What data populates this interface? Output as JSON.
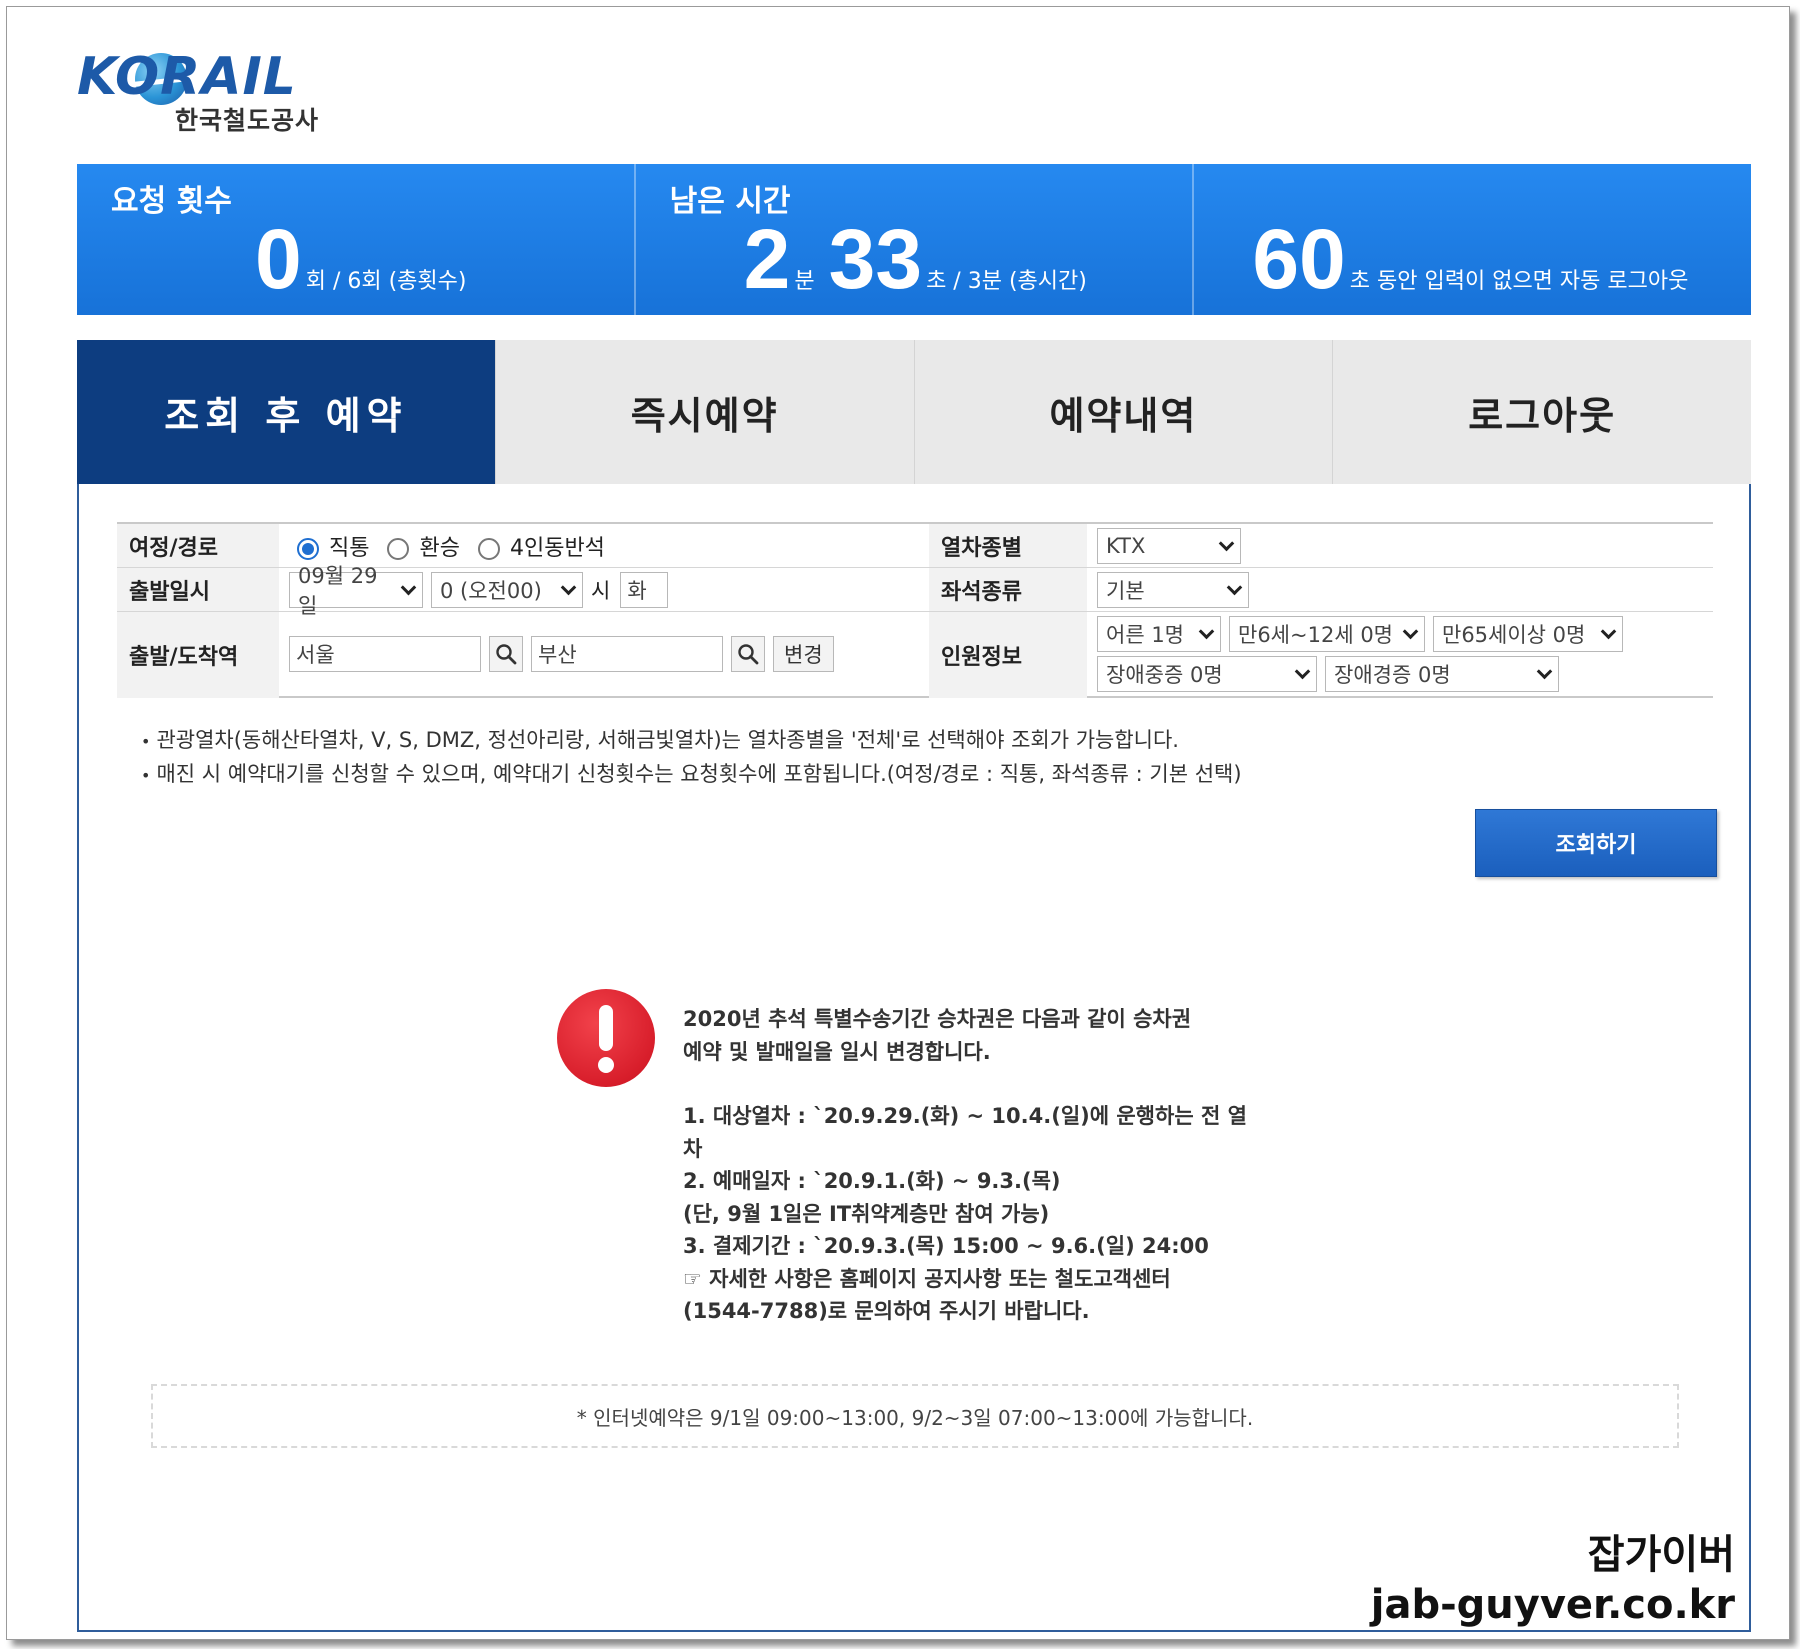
{
  "logo": {
    "wordmark": "KORAIL",
    "subtitle": "한국철도공사"
  },
  "stats": {
    "requests": {
      "title": "요청 횟수",
      "value": "0",
      "unit": "회 / 6회 (총횟수)"
    },
    "remaining": {
      "title": "남은 시간",
      "minutes": "2",
      "min_unit": "분",
      "seconds": "33",
      "sec_unit": "초 / 3분 (총시간)"
    },
    "idle": {
      "value": "60",
      "text": "초 동안 입력이 없으면 자동 로그아웃"
    }
  },
  "tabs": [
    {
      "label": "조회 후 예약"
    },
    {
      "label": "즉시예약"
    },
    {
      "label": "예약내역"
    },
    {
      "label": "로그아웃"
    }
  ],
  "form": {
    "route_label": "여정/경로",
    "route_options": [
      "직통",
      "환승",
      "4인동반석"
    ],
    "route_selected": "직통",
    "train_type_label": "열차종별",
    "train_type_value": "KTX",
    "date_label": "출발일시",
    "date_value": "09월 29일",
    "time_value": "0 (오전00)",
    "hour_suffix": "시",
    "weekday": "화",
    "seat_label": "좌석종류",
    "seat_value": "기본",
    "station_label": "출발/도착역",
    "from_station": "서울",
    "to_station": "부산",
    "change_button": "변경",
    "people_label": "인원정보",
    "adult": "어른 1명",
    "child": "만6세~12세 0명",
    "senior": "만65세이상 0명",
    "disabled_severe": "장애중증 0명",
    "disabled_mild": "장애경증 0명"
  },
  "notes": [
    "관광열차(동해산타열차, V, S, DMZ, 정선아리랑, 서해금빛열차)는 열차종별을 '전체'로 선택해야 조회가 가능합니다.",
    "매진 시 예약대기를 신청할 수 있으며, 예약대기 신청횟수는 요청횟수에 포함됩니다.(여정/경로 : 직통, 좌석종류 : 기본 선택)"
  ],
  "search_button": "조회하기",
  "notice": {
    "intro1": "2020년 추석 특별수송기간 승차권은 다음과 같이 승차권",
    "intro2": "예약 및 발매일을 일시 변경합니다.",
    "item1a": "1. 대상열차 : `20.9.29.(화) ~ 10.4.(일)에 운행하는 전 열",
    "item1b": "차",
    "item2a": "2. 예매일자 : `20.9.1.(화) ~ 9.3.(목)",
    "item2b": "(단, 9월 1일은 IT취약계층만 참여 가능)",
    "item3": "3. 결제기간 : `20.9.3.(목) 15:00 ~ 9.6.(일) 24:00",
    "contact1": "☞ 자세한 사항은 홈페이지 공지사항 또는 철도고객센터",
    "contact2": "(1544-7788)로 문의하여 주시기 바랍니다."
  },
  "footer_note": "* 인터넷예약은 9/1일 09:00~13:00, 9/2~3일 07:00~13:00에 가능합니다.",
  "watermark": {
    "korean": "잡가이버",
    "url": "jab-guyver.co.kr"
  },
  "colors": {
    "stats_blue": "#1f7ee6",
    "tab_active": "#0d3d80",
    "alert_red": "#d81e2b",
    "button_blue": "#2369c9"
  }
}
